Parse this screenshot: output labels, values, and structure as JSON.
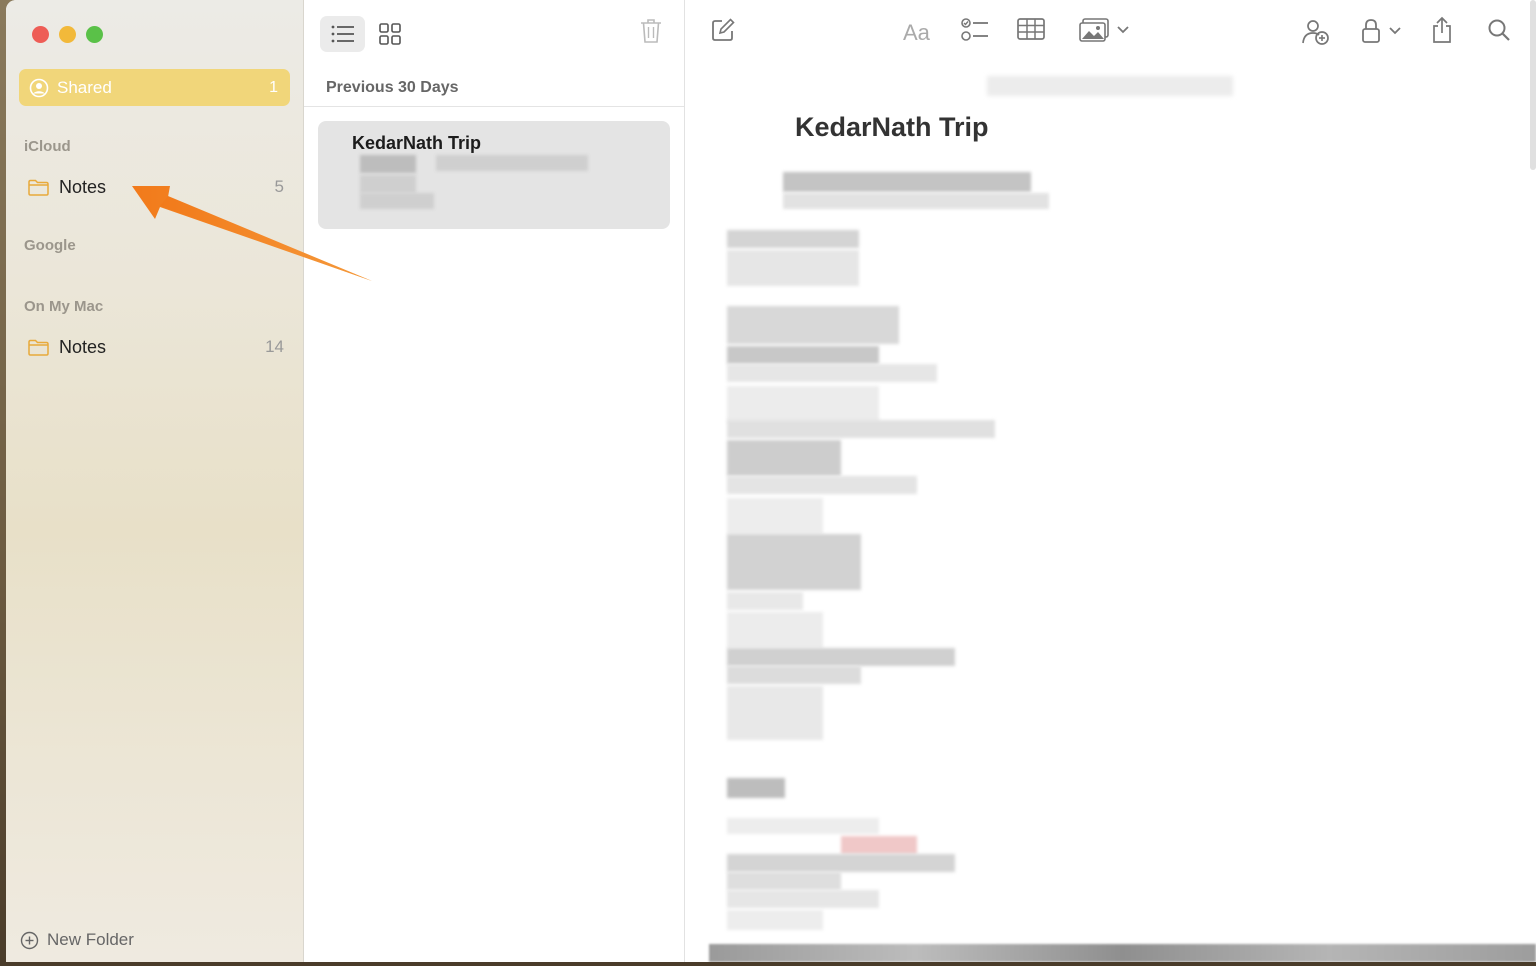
{
  "window": {
    "traffic_lights": [
      "close",
      "minimize",
      "zoom"
    ]
  },
  "sidebar": {
    "shared": {
      "label": "Shared",
      "count": "1",
      "icon": "person-circle-icon"
    },
    "sections": [
      {
        "header": "iCloud",
        "folders": [
          {
            "label": "Notes",
            "count": "5",
            "icon": "folder-icon"
          }
        ]
      },
      {
        "header": "Google",
        "folders": []
      },
      {
        "header": "On My Mac",
        "folders": [
          {
            "label": "Notes",
            "count": "14",
            "icon": "folder-icon"
          }
        ]
      }
    ],
    "new_folder_label": "New Folder"
  },
  "list": {
    "section_header": "Previous 30 Days",
    "notes": [
      {
        "title": "KedarNath Trip"
      }
    ]
  },
  "editor": {
    "title": "KedarNath Trip",
    "toolbar_icons": [
      "compose-icon",
      "format-text-icon",
      "checklist-icon",
      "table-icon",
      "media-icon",
      "collaborate-icon",
      "lock-icon",
      "share-icon",
      "search-icon"
    ],
    "format_label": "Aa"
  },
  "colors": {
    "accent": "#f1d67a",
    "annotation_arrow": "#f07a1d"
  }
}
